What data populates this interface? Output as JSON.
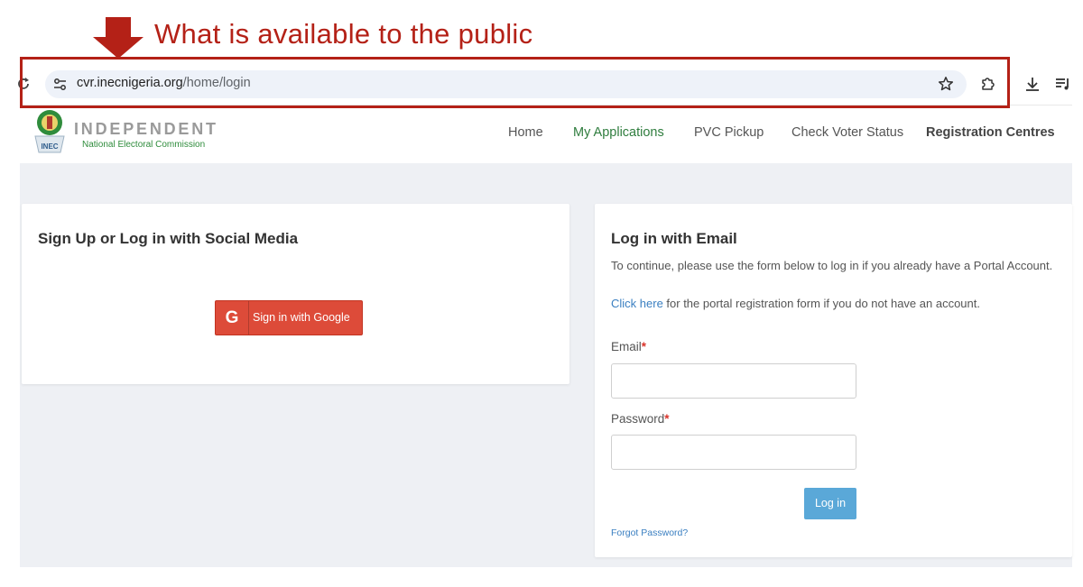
{
  "annotation": {
    "caption": "What is available to the public",
    "color": "#b42117"
  },
  "browser": {
    "url_host": "cvr.inecnigeria.org",
    "url_path": "/home/login",
    "icons": [
      "reload-icon",
      "site-settings-icon",
      "bookmark-star-icon",
      "extensions-icon",
      "download-icon",
      "media-controls-icon"
    ]
  },
  "site": {
    "logo_title": "INDEPENDENT",
    "logo_subtitle": "National Electoral Commission",
    "logo_emblem_text": "INEC",
    "brand_green": "#2f8c3c",
    "nav": [
      {
        "label": "Home"
      },
      {
        "label": "My Applications"
      },
      {
        "label": "PVC Pickup"
      },
      {
        "label": "Check Voter Status"
      },
      {
        "label": "Registration Centres"
      }
    ]
  },
  "social": {
    "title": "Sign Up or Log in with Social Media",
    "google_icon": "G",
    "google_label": "Sign in with Google",
    "google_color": "#dd4b39"
  },
  "email_login": {
    "title": "Log in with Email",
    "intro": "To continue, please use the form below to log in if you already have a Portal Account.",
    "register_link": "Click here",
    "register_rest": " for the portal registration form if you do not have an account.",
    "email_label": "Email",
    "password_label": "Password",
    "required_mark": "*",
    "email_value": "",
    "password_value": "",
    "login_button": "Log in",
    "forgot_link": "Forgot Password?",
    "button_color": "#5aa8d8"
  }
}
